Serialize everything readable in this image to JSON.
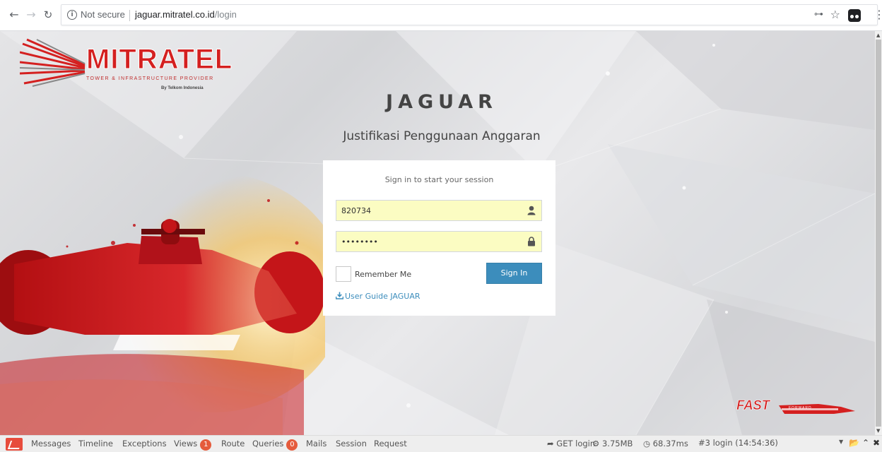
{
  "browser": {
    "back_icon": "arrow-left-icon",
    "forward_icon": "arrow-right-icon",
    "reload_icon": "reload-icon",
    "security_label": "Not secure",
    "url_host": "jaguar.mitratel.co.id",
    "url_path": "/login",
    "info_glyph": "i"
  },
  "logo": {
    "name": "MITRATEL",
    "tagline": "TOWER & INFRASTRUCTURE PROVIDER",
    "by": "By Telkom Indonesia"
  },
  "app": {
    "title": "JAGUAR",
    "subtitle": "Justifikasi Penggunaan Anggaran"
  },
  "login": {
    "message": "Sign in to start your session",
    "username_value": "820734",
    "password_value": "••••••••",
    "remember_label": "Remember Me",
    "signin_label": "Sign In",
    "guide_label": "User Guide JAGUAR"
  },
  "footer_logo": {
    "text": "FAST",
    "sub": "FORWARD"
  },
  "debugbar": {
    "tabs": [
      {
        "label": "Messages"
      },
      {
        "label": "Timeline"
      },
      {
        "label": "Exceptions"
      },
      {
        "label": "Views",
        "badge": "1"
      },
      {
        "label": "Route"
      },
      {
        "label": "Queries",
        "badge": "0"
      },
      {
        "label": "Mails"
      },
      {
        "label": "Session"
      },
      {
        "label": "Request"
      }
    ],
    "request": "GET login",
    "memory": "3.75MB",
    "time": "68.37ms",
    "dataset": "#3 login (14:54:36)"
  },
  "colors": {
    "brand_red": "#d42020",
    "button_blue": "#3c8dbc",
    "autofill_yellow": "#fbfcc2",
    "badge_red": "#e55b3c"
  }
}
